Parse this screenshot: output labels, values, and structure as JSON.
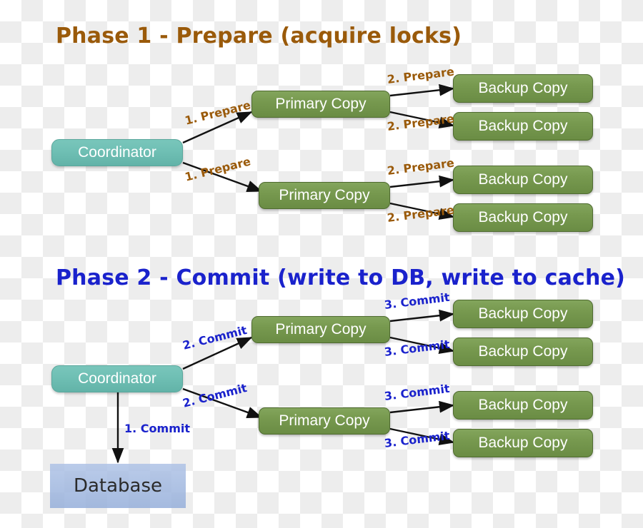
{
  "diagram": {
    "title_phase1": "Phase 1 - Prepare (acquire locks)",
    "title_phase2": "Phase 2 - Commit (write to DB, write to cache)",
    "colors": {
      "phase1_accent": "#9a5a0a",
      "phase2_accent": "#1a22cc",
      "coordinator_fill": "#6fbfb4",
      "node_fill": "#77994f",
      "node_border": "#4f6b30",
      "database_fill": "#96afda",
      "arrow": "#111111",
      "node_text": "#ffffff",
      "database_text": "#2b2b2b",
      "background": "#ffffff",
      "checker": "#ededed"
    }
  },
  "phase1": {
    "coordinator": {
      "label": "Coordinator"
    },
    "primaries": [
      {
        "label": "Primary Copy"
      },
      {
        "label": "Primary Copy"
      }
    ],
    "backups": [
      {
        "label": "Backup Copy"
      },
      {
        "label": "Backup Copy"
      },
      {
        "label": "Backup Copy"
      },
      {
        "label": "Backup Copy"
      }
    ],
    "edges": [
      {
        "label": "1. Prepare"
      },
      {
        "label": "1. Prepare"
      },
      {
        "label": "2. Prepare"
      },
      {
        "label": "2. Prepare"
      },
      {
        "label": "2. Prepare"
      },
      {
        "label": "2. Prepare"
      }
    ]
  },
  "phase2": {
    "coordinator": {
      "label": "Coordinator"
    },
    "database": {
      "label": "Database"
    },
    "primaries": [
      {
        "label": "Primary Copy"
      },
      {
        "label": "Primary Copy"
      }
    ],
    "backups": [
      {
        "label": "Backup Copy"
      },
      {
        "label": "Backup Copy"
      },
      {
        "label": "Backup Copy"
      },
      {
        "label": "Backup Copy"
      }
    ],
    "edges": [
      {
        "label": "1. Commit"
      },
      {
        "label": "2. Commit"
      },
      {
        "label": "2. Commit"
      },
      {
        "label": "3. Commit"
      },
      {
        "label": "3. Commit"
      },
      {
        "label": "3. Commit"
      },
      {
        "label": "3. Commit"
      }
    ]
  }
}
